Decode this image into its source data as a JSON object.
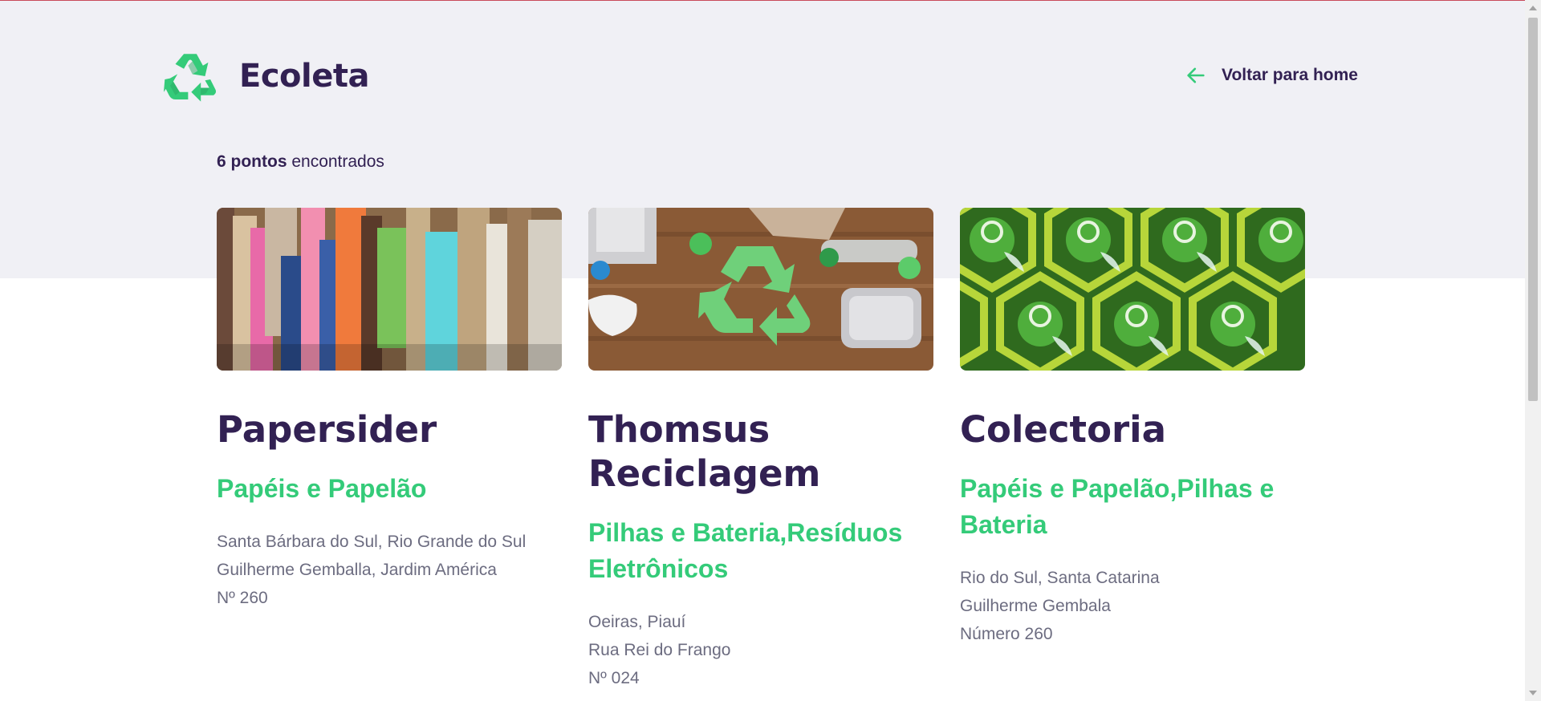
{
  "app": {
    "name": "Ecoleta",
    "logo_icon": "recycle-icon"
  },
  "nav": {
    "back_label": "Voltar para home",
    "back_icon": "arrow-left-icon"
  },
  "results": {
    "count_label": "6 pontos",
    "suffix": " encontrados"
  },
  "colors": {
    "primary": "#34cb79",
    "title": "#322153",
    "text": "#6c6c80",
    "background": "#f0f0f5"
  },
  "points": [
    {
      "name": "Papersider",
      "items": "Papéis e Papelão",
      "address_line1": "Santa Bárbara do Sul, Rio Grande do Sul",
      "address_line2": "Guilherme Gemballa, Jardim América",
      "address_line3": "Nº 260",
      "image": "paper-cardboard-bales-image"
    },
    {
      "name": "Thomsus Reciclagem",
      "items": "Pilhas e Bateria,Resíduos Eletrônicos",
      "address_line1": "Oeiras, Piauí",
      "address_line2": "Rua Rei do Frango",
      "address_line3": "Nº 024",
      "image": "recycling-symbol-on-wood-image"
    },
    {
      "name": "Colectoria",
      "items": "Papéis e Papelão,Pilhas e Bateria",
      "address_line1": "Rio do Sul, Santa Catarina",
      "address_line2": "Guilherme Gembala",
      "address_line3": "Número 260",
      "image": "green-glass-bottles-image"
    }
  ]
}
